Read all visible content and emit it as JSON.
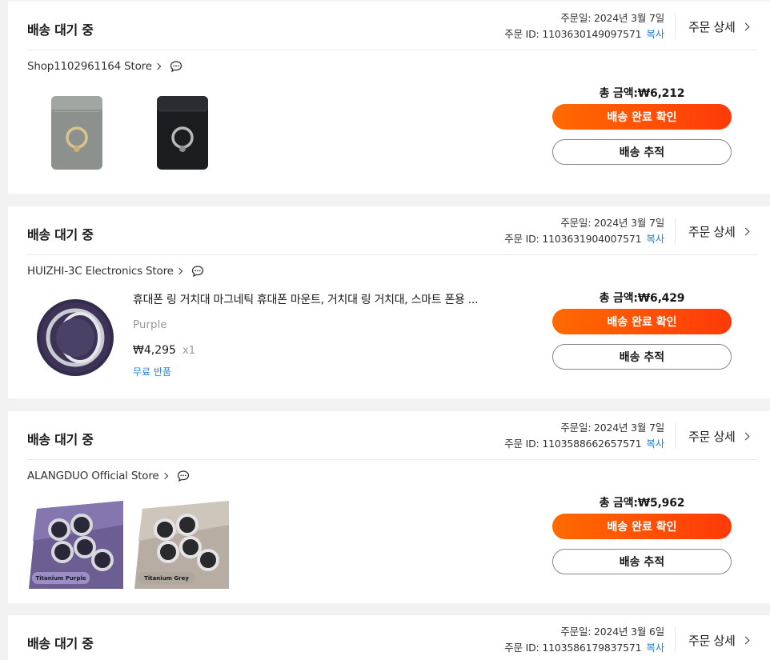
{
  "orders": [
    {
      "status": "배송 대기 중",
      "order_date": "주문일: 2024년 3월 7일",
      "order_id": "주문 ID: 1103630149097571",
      "copy_label": "복사",
      "detail_label": "주문 상세",
      "store_name": "Shop1102961164 Store",
      "total": "총 금액:₩6,212",
      "confirm_label": "배송 완료 확인",
      "track_label": "배송 추적",
      "thumbnails": [
        "grey-ring-phone-wallet",
        "black-ring-phone-wallet"
      ]
    },
    {
      "status": "배송 대기 중",
      "order_date": "주문일: 2024년 3월 7일",
      "order_id": "주문 ID: 1103631904007571",
      "copy_label": "복사",
      "detail_label": "주문 상세",
      "store_name": "HUIZHI-3C Electronics Store",
      "total": "총 금액:₩6,429",
      "confirm_label": "배송 완료 확인",
      "track_label": "배송 추적",
      "item": {
        "title": "휴대폰 링 거치대 마그네틱 휴대폰 마운트, 거치대 링 거치대, 스마트 폰용 ...",
        "variant": "Purple",
        "price": "₩4,295",
        "qty": "x1",
        "return_label": "무료 반품"
      }
    },
    {
      "status": "배송 대기 중",
      "order_date": "주문일: 2024년 3월 7일",
      "order_id": "주문 ID: 1103588662657571",
      "copy_label": "복사",
      "detail_label": "주문 상세",
      "store_name": "ALANGDUO Official Store",
      "total": "총 금액:₩5,962",
      "confirm_label": "배송 완료 확인",
      "track_label": "배송 추적",
      "thumbnails": [
        {
          "kind": "camera-lens-protector-purple",
          "label": "Titanium Purple"
        },
        {
          "kind": "camera-lens-protector-grey",
          "label": "Titanium Grey"
        }
      ]
    },
    {
      "status": "배송 대기 중",
      "order_date": "주문일: 2024년 3월 6일",
      "order_id": "주문 ID: 1103586179837571",
      "copy_label": "복사",
      "detail_label": "주문 상세"
    }
  ],
  "colors": {
    "accent_gradient_start": "#ff6a00",
    "accent_gradient_end": "#fe3a09",
    "link_blue": "#2a7fd6",
    "page_bg": "#f2f2f2"
  },
  "icons": {
    "store_chevron": "chevron-right-icon",
    "chat": "chat-bubble-icon",
    "detail_chevron": "chevron-right-icon"
  }
}
